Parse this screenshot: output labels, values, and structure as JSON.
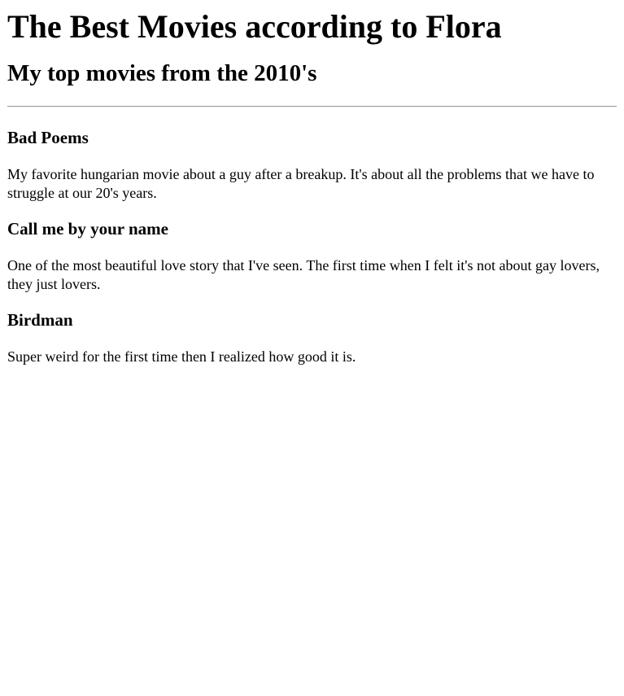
{
  "page": {
    "title": "The Best Movies according to Flora",
    "subtitle": "My top movies from the 2010's"
  },
  "movies": [
    {
      "title": "Bad Poems",
      "description": "My favorite hungarian movie about a guy after a breakup. It's about all the problems that we have to struggle at our 20's years."
    },
    {
      "title": "Call me by your name",
      "description": "One of the most beautiful love story that I've seen. The first time when I felt it's not about gay lovers, they just lovers."
    },
    {
      "title": "Birdman",
      "description": "Super weird for the first time then I realized how good it is."
    }
  ]
}
